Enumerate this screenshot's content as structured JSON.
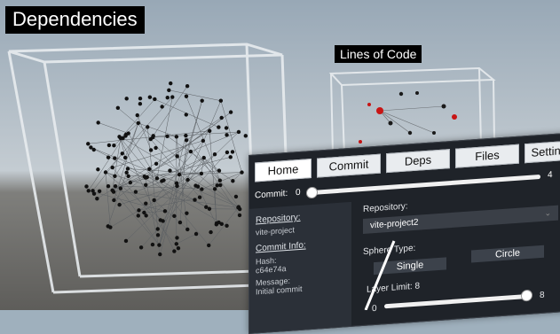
{
  "scene": {
    "title_dependencies": "Dependencies",
    "title_lines_of_code": "Lines of Code"
  },
  "panel": {
    "tabs": [
      {
        "label": "Home",
        "active": true
      },
      {
        "label": "Commit",
        "active": false
      },
      {
        "label": "Deps",
        "active": false
      },
      {
        "label": "Files",
        "active": false
      },
      {
        "label": "Settings",
        "active": false
      }
    ],
    "commit_slider": {
      "label": "Commit:",
      "min": "0",
      "max": "4",
      "value": 0
    },
    "sidebar": {
      "repository_heading": "Repository:",
      "repository_value": "vite-project",
      "commit_info_heading": "Commit Info:",
      "hash_label": "Hash:",
      "hash_value": "c64e74a",
      "message_label": "Message:",
      "message_value": "Initial commit"
    },
    "settings": {
      "repository_label": "Repository:",
      "repository_selected": "vite-project2",
      "sphere_type_label": "Sphere Type:",
      "sphere_options": [
        "Single",
        "Circle"
      ],
      "layer_limit_label": "Layer Limit: 8",
      "layer_min": "0",
      "layer_max": "8",
      "layer_value": 8
    }
  }
}
